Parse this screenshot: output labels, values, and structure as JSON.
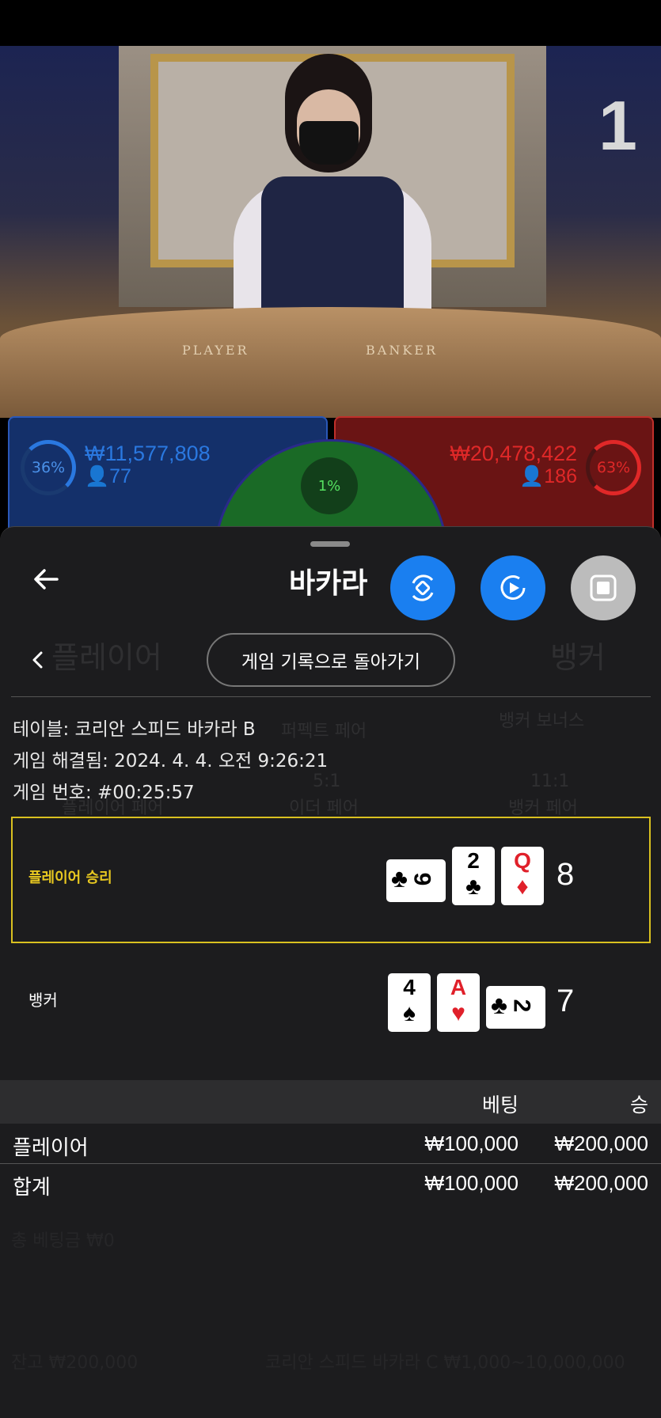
{
  "video": {
    "round_number": "1",
    "table_left": "PLAYER",
    "table_right": "BANKER"
  },
  "bets": {
    "player": {
      "percent": "36%",
      "amount": "₩11,577,808",
      "users": "77",
      "pct_value": 36
    },
    "banker": {
      "percent": "63%",
      "amount": "₩20,478,422",
      "users": "186",
      "pct_value": 63
    },
    "tie": {
      "percent": "1%"
    }
  },
  "background_ghost": {
    "player_label": "플레이어",
    "banker_label": "뱅커",
    "dragon_bonus": "뱅커 보너스",
    "perfect_pair": "퍼펙트 페어",
    "either_odds": "5:1",
    "either_pair": "이더 페어",
    "banker_pair_odds": "11:1",
    "banker_pair": "뱅커 페어",
    "player_pair": "플레이어 페어",
    "footer_balance": "잔고 ₩200,000",
    "footer_total": "총 베팅금 ₩0",
    "footer_table": "코리안 스피드 바카라 C ₩1,000~10,000,000"
  },
  "header": {
    "title": "바카라",
    "back_icon": "arrow-left-icon"
  },
  "history_nav": {
    "back_to_history": "게임 기록으로 돌아가기"
  },
  "game_info": {
    "table": "테이블: 코리안 스피드 바카라 B",
    "resolved": "게임 해결됨: 2024. 4. 4. 오전 9:26:21",
    "game_number": "게임 번호: #00:25:57"
  },
  "result": {
    "player": {
      "label": "플레이어 승리",
      "score": "8",
      "cards": [
        {
          "rank": "9",
          "suit": "♣",
          "color": "#000000",
          "rotated": true
        },
        {
          "rank": "2",
          "suit": "♣",
          "color": "#000000",
          "rotated": false
        },
        {
          "rank": "Q",
          "suit": "♦",
          "color": "#e0202a",
          "rotated": false
        }
      ]
    },
    "banker": {
      "label": "뱅커",
      "score": "7",
      "cards": [
        {
          "rank": "4",
          "suit": "♠",
          "color": "#000000",
          "rotated": false
        },
        {
          "rank": "A",
          "suit": "♥",
          "color": "#e0202a",
          "rotated": false
        },
        {
          "rank": "2",
          "suit": "♣",
          "color": "#000000",
          "rotated": true
        }
      ]
    }
  },
  "bet_table": {
    "headers": {
      "bet": "베팅",
      "win": "승"
    },
    "rows": [
      {
        "name": "플레이어",
        "bet": "₩100,000",
        "win": "₩200,000"
      },
      {
        "name": "합계",
        "bet": "₩100,000",
        "win": "₩200,000"
      }
    ]
  },
  "colors": {
    "accent_blue": "#1a7ff0",
    "highlight_yellow": "#d9c020",
    "player_blue": "#2a78e0",
    "banker_red": "#e02828"
  }
}
